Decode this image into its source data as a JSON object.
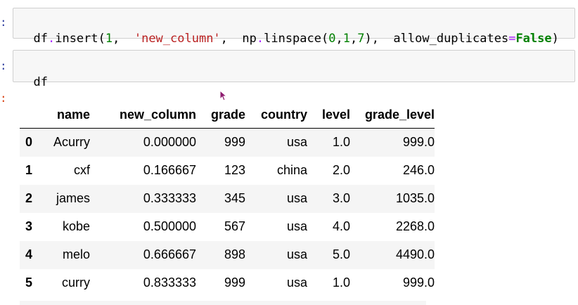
{
  "cells": {
    "in1": {
      "prompt": ":",
      "code_tokens": [
        {
          "t": "df",
          "c": ""
        },
        {
          "t": ".",
          "c": "op"
        },
        {
          "t": "insert(",
          "c": ""
        },
        {
          "t": "1",
          "c": "num"
        },
        {
          "t": ",  ",
          "c": ""
        },
        {
          "t": "'new_column'",
          "c": "str"
        },
        {
          "t": ",  np",
          "c": ""
        },
        {
          "t": ".",
          "c": "op"
        },
        {
          "t": "linspace(",
          "c": ""
        },
        {
          "t": "0",
          "c": "num"
        },
        {
          "t": ",",
          "c": ""
        },
        {
          "t": "1",
          "c": "num"
        },
        {
          "t": ",",
          "c": ""
        },
        {
          "t": "7",
          "c": "num"
        },
        {
          "t": "),  allow_duplicates",
          "c": ""
        },
        {
          "t": "=",
          "c": "op"
        },
        {
          "t": "False",
          "c": "kw"
        },
        {
          "t": ")",
          "c": ""
        }
      ]
    },
    "in2": {
      "prompt": ":",
      "code": "df"
    },
    "out2": {
      "prompt": ":"
    }
  },
  "table": {
    "columns": [
      "",
      "name",
      "new_column",
      "grade",
      "country",
      "level",
      "grade_level"
    ],
    "rows": [
      [
        "0",
        "Acurry",
        "0.000000",
        "999",
        "usa",
        "1.0",
        "999.0"
      ],
      [
        "1",
        "cxf",
        "0.166667",
        "123",
        "china",
        "2.0",
        "246.0"
      ],
      [
        "2",
        "james",
        "0.333333",
        "345",
        "usa",
        "3.0",
        "1035.0"
      ],
      [
        "3",
        "kobe",
        "0.500000",
        "567",
        "usa",
        "4.0",
        "2268.0"
      ],
      [
        "4",
        "melo",
        "0.666667",
        "898",
        "usa",
        "5.0",
        "4490.0"
      ],
      [
        "5",
        "curry",
        "0.833333",
        "999",
        "usa",
        "1.0",
        "999.0"
      ]
    ]
  },
  "colors": {
    "in_prompt": "#303f9f",
    "out_prompt": "#d84315",
    "string": "#ba2121",
    "number": "#008000",
    "keyword": "#008000",
    "operator": "#aa22ff",
    "cell_bg": "#f7f7f7",
    "row_stripe": "#f5f5f5"
  },
  "icons": {
    "cursor": "mouse-pointer-icon"
  }
}
